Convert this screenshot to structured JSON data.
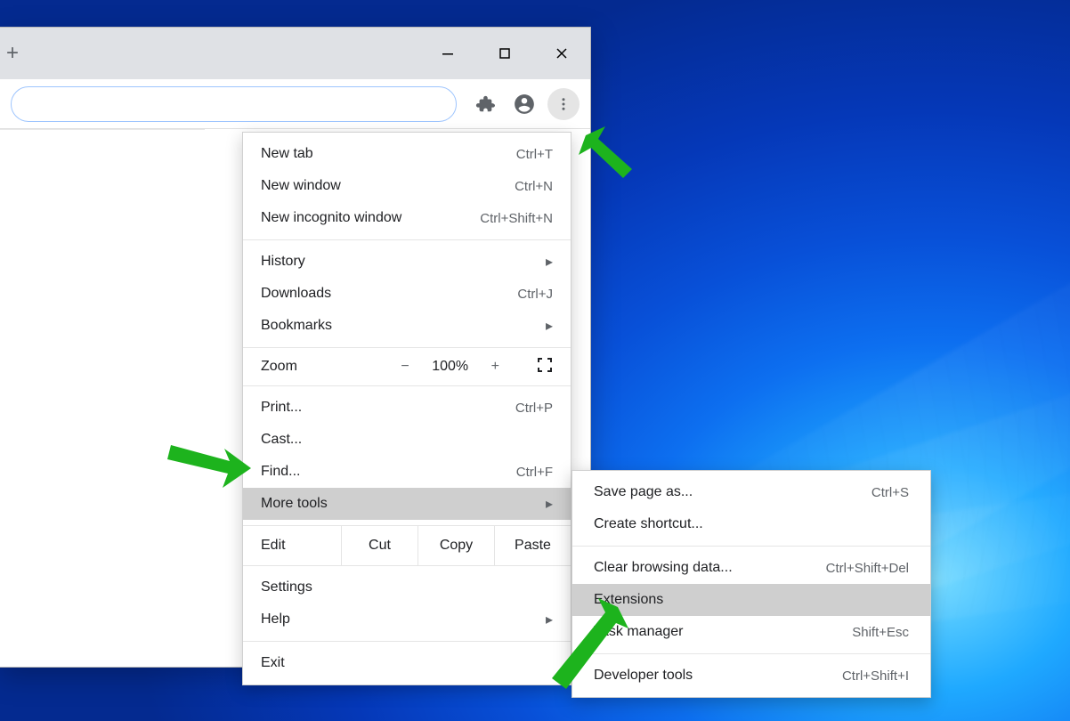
{
  "window_controls": {
    "minimize": "minimize",
    "maximize": "maximize",
    "close": "close"
  },
  "menu": {
    "new_tab": {
      "label": "New tab",
      "accel": "Ctrl+T"
    },
    "new_window": {
      "label": "New window",
      "accel": "Ctrl+N"
    },
    "incognito": {
      "label": "New incognito window",
      "accel": "Ctrl+Shift+N"
    },
    "history": {
      "label": "History"
    },
    "downloads": {
      "label": "Downloads",
      "accel": "Ctrl+J"
    },
    "bookmarks": {
      "label": "Bookmarks"
    },
    "zoom": {
      "label": "Zoom",
      "minus": "−",
      "pct": "100%",
      "plus": "+"
    },
    "print": {
      "label": "Print...",
      "accel": "Ctrl+P"
    },
    "cast": {
      "label": "Cast..."
    },
    "find": {
      "label": "Find...",
      "accel": "Ctrl+F"
    },
    "more_tools": {
      "label": "More tools"
    },
    "edit": {
      "label": "Edit",
      "cut": "Cut",
      "copy": "Copy",
      "paste": "Paste"
    },
    "settings": {
      "label": "Settings"
    },
    "help": {
      "label": "Help"
    },
    "exit": {
      "label": "Exit"
    }
  },
  "submenu": {
    "save_page": {
      "label": "Save page as...",
      "accel": "Ctrl+S"
    },
    "create_shortcut": {
      "label": "Create shortcut..."
    },
    "clear_data": {
      "label": "Clear browsing data...",
      "accel": "Ctrl+Shift+Del"
    },
    "extensions": {
      "label": "Extensions"
    },
    "task_manager": {
      "label": "Task manager",
      "accel": "Shift+Esc"
    },
    "dev_tools": {
      "label": "Developer tools",
      "accel": "Ctrl+Shift+I"
    }
  }
}
